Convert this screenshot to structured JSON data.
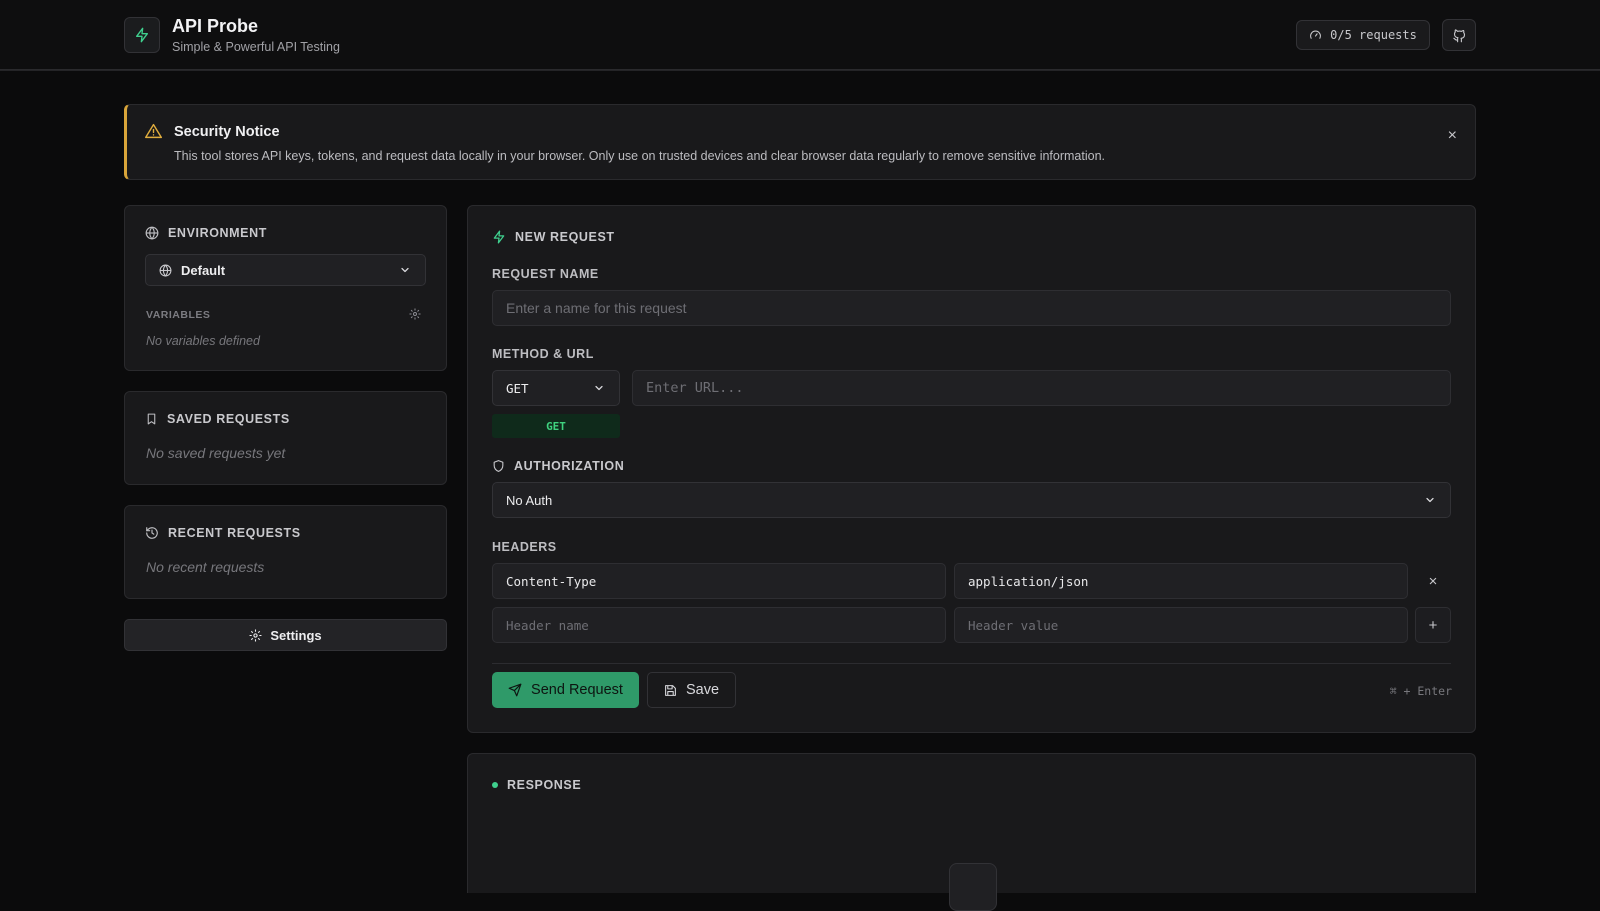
{
  "header": {
    "app_title": "API Probe",
    "app_subtitle": "Simple & Powerful API Testing",
    "quota_label": "0/5 requests",
    "logo_icon": "bolt-icon",
    "github_icon": "github-icon"
  },
  "notice": {
    "title": "Security Notice",
    "text": "This tool stores API keys, tokens, and request data locally in your browser. Only use on trusted devices and clear browser data regularly to remove sensitive information.",
    "close_glyph": "×",
    "accent_color": "#d9a53a"
  },
  "sidebar": {
    "environment": {
      "title": "ENVIRONMENT",
      "selected": "Default",
      "variables_label": "VARIABLES",
      "variables_empty": "No variables defined"
    },
    "saved": {
      "title": "SAVED REQUESTS",
      "empty": "No saved requests yet"
    },
    "recent": {
      "title": "RECENT REQUESTS",
      "empty": "No recent requests"
    },
    "settings_label": "Settings"
  },
  "request": {
    "title": "NEW REQUEST",
    "name_label": "REQUEST NAME",
    "name_placeholder": "Enter a name for this request",
    "method_url_label": "METHOD & URL",
    "method": "GET",
    "url_placeholder": "Enter URL...",
    "method_badge": "GET",
    "auth_label": "AUTHORIZATION",
    "auth_selected": "No Auth",
    "headers_label": "HEADERS",
    "headers": [
      {
        "name": "Content-Type",
        "value": "application/json"
      }
    ],
    "header_name_placeholder": "Header name",
    "header_value_placeholder": "Header value",
    "remove_glyph": "×",
    "add_glyph": "+",
    "send_label": "Send Request",
    "save_label": "Save",
    "shortcut": "⌘ + Enter"
  },
  "response": {
    "title": "RESPONSE"
  },
  "colors": {
    "accent": "#2f9a69",
    "method_get": "#3fd17e",
    "background": "#0b0b0c",
    "panel": "#19191b"
  }
}
